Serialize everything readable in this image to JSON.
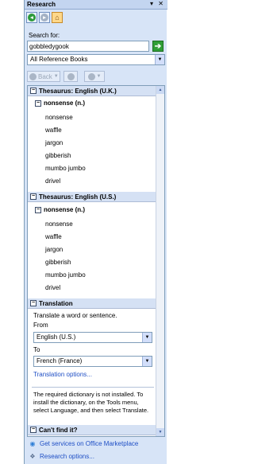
{
  "pane": {
    "title": "Research",
    "title_icons": "▾ ✕"
  },
  "nav": {
    "buttons": [
      "back-nav",
      "forward-nav",
      "home"
    ]
  },
  "search": {
    "label": "Search for:",
    "value": "gobbledygook",
    "go_glyph": "➔"
  },
  "reference": {
    "selected": "All Reference Books"
  },
  "toolbar": {
    "back_label": "Back"
  },
  "thesaurus_uk": {
    "header": "Thesaurus: English (U.K.)",
    "headword": "nonsense (n.)",
    "words": [
      "nonsense",
      "waffle",
      "jargon",
      "gibberish",
      "mumbo jumbo",
      "drivel"
    ]
  },
  "thesaurus_us": {
    "header": "Thesaurus: English (U.S.)",
    "headword": "nonsense (n.)",
    "words": [
      "nonsense",
      "waffle",
      "jargon",
      "gibberish",
      "mumbo jumbo",
      "drivel"
    ]
  },
  "translation": {
    "header": "Translation",
    "instruction": "Translate a word or sentence.",
    "from_label": "From",
    "from_value": "English (U.S.)",
    "to_label": "To",
    "to_value": "French (France)",
    "options_link": "Translation options...",
    "note": "The required dictionary is not installed. To install the dictionary, on the Tools menu, select Language, and then select Translate."
  },
  "cant_find": {
    "header": "Can't find it?"
  },
  "footer": {
    "marketplace": "Get services on Office Marketplace",
    "research_options": "Research options..."
  },
  "colors": {
    "pane_bg": "#d7e4f7",
    "link": "#1f4fc5",
    "go_green": "#2f9e36"
  }
}
